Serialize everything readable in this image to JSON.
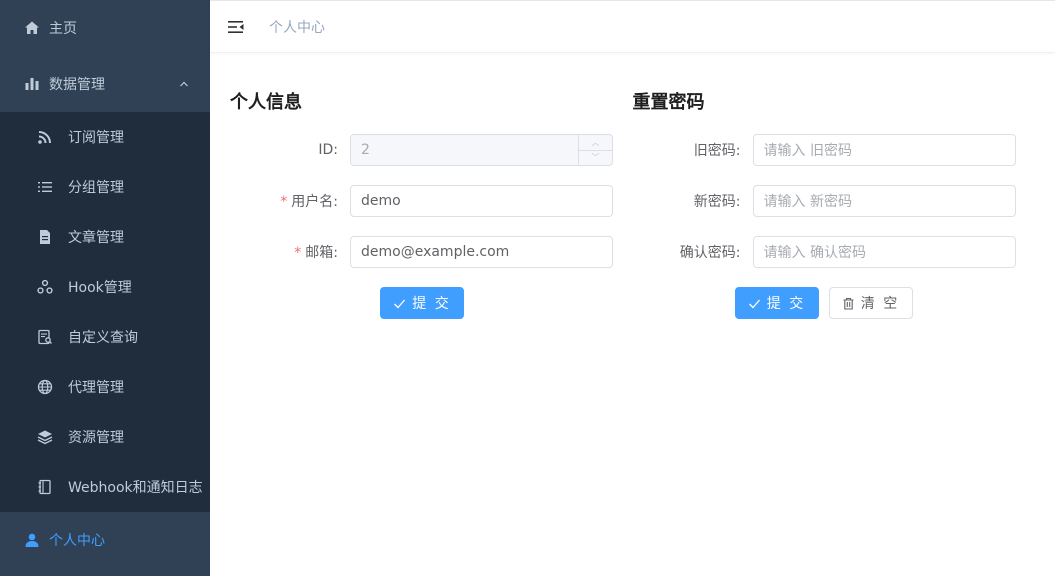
{
  "sidebar": {
    "items": [
      {
        "label": "主页",
        "icon": "home-icon"
      },
      {
        "label": "数据管理",
        "icon": "bar-chart-icon",
        "expanded": true
      },
      {
        "label": "个人中心",
        "icon": "user-icon",
        "active": true
      }
    ],
    "submenu": [
      {
        "label": "订阅管理",
        "icon": "rss-icon"
      },
      {
        "label": "分组管理",
        "icon": "list-icon"
      },
      {
        "label": "文章管理",
        "icon": "document-icon"
      },
      {
        "label": "Hook管理",
        "icon": "hook-icon"
      },
      {
        "label": "自定义查询",
        "icon": "query-icon"
      },
      {
        "label": "代理管理",
        "icon": "globe-icon"
      },
      {
        "label": "资源管理",
        "icon": "layers-icon"
      },
      {
        "label": "Webhook和通知日志",
        "icon": "notebook-icon"
      }
    ]
  },
  "navbar": {
    "breadcrumb": "个人中心"
  },
  "profile": {
    "title": "个人信息",
    "id_label": "ID:",
    "id_value": "2",
    "username_label": "用户名:",
    "username_value": "demo",
    "email_label": "邮箱:",
    "email_value": "demo@example.com",
    "required_mark": "*",
    "submit_label": "提 交"
  },
  "password": {
    "title": "重置密码",
    "old_label": "旧密码:",
    "old_placeholder": "请输入 旧密码",
    "new_label": "新密码:",
    "new_placeholder": "请输入 新密码",
    "confirm_label": "确认密码:",
    "confirm_placeholder": "请输入 确认密码",
    "submit_label": "提 交",
    "clear_label": "清 空"
  },
  "colors": {
    "sidebar_bg": "#304156",
    "submenu_bg": "#1f2d3d",
    "accent": "#409eff",
    "required": "#f56c6c"
  }
}
